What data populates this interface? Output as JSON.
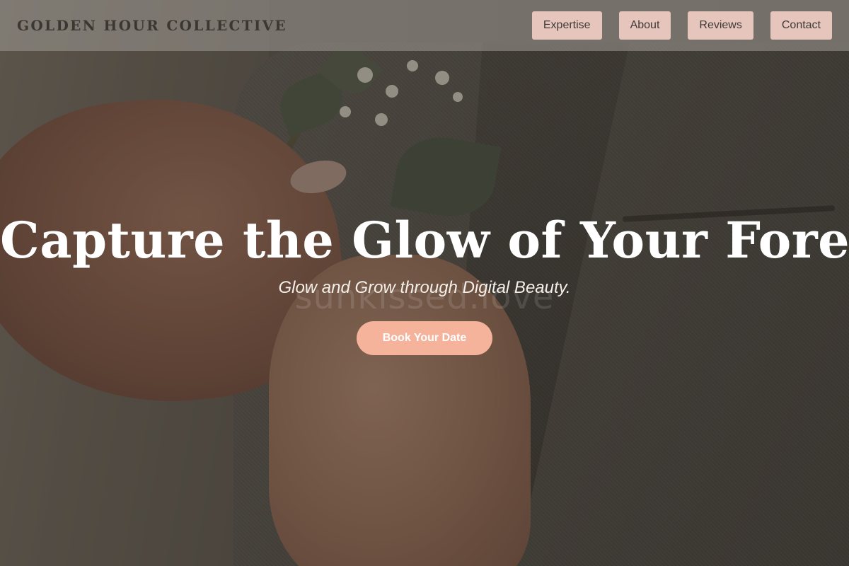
{
  "header": {
    "brand": "GOLDEN HOUR COLLECTIVE",
    "nav": [
      {
        "label": "Expertise"
      },
      {
        "label": "About"
      },
      {
        "label": "Reviews"
      },
      {
        "label": "Contact"
      }
    ]
  },
  "hero": {
    "title": "Capture the Glow of Your Forever",
    "subtitle": "Glow and Grow through Digital Beauty.",
    "cta_label": "Book Your Date",
    "watermark": "sunkissed.love"
  },
  "colors": {
    "nav_button_bg": "#e6c5bd",
    "cta_bg": "#f6b39c",
    "header_bg": "#96918a",
    "brand_text": "#3b3733"
  }
}
